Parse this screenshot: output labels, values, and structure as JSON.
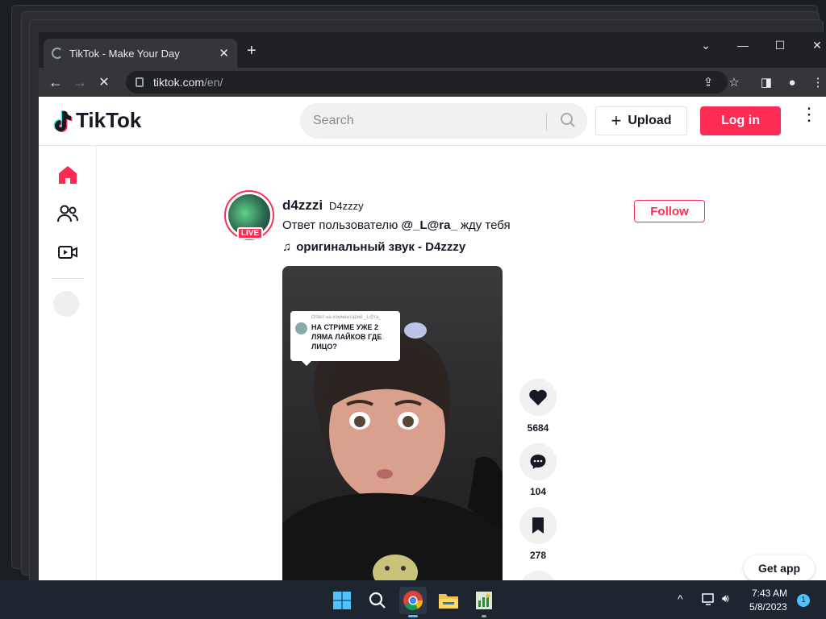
{
  "browser": {
    "tab_title": "TikTok - Make Your Day",
    "url_host": "tiktok.com",
    "url_path": "/en/"
  },
  "header": {
    "logo_text": "TikTok",
    "search_placeholder": "Search",
    "upload_label": "Upload",
    "login_label": "Log in"
  },
  "post": {
    "username": "d4zzzi",
    "nickname": "D4zzzy",
    "live_badge": "LIVE",
    "desc_prefix": "Ответ пользователю ",
    "desc_mention": "@_L@ra_",
    "desc_suffix": " жду тебя",
    "music": "оригинальный звук - D4zzzy",
    "follow_label": "Follow",
    "reply_header": "Ответ на комментарий _L@ra_",
    "reply_text": "НА СТРИМЕ УЖЕ 2 ЛЯМА ЛАЙКОВ ГДЕ ЛИЦО?",
    "likes": "5684",
    "comments": "104",
    "saves": "278"
  },
  "get_app_label": "Get app",
  "taskbar": {
    "time": "7:43 AM",
    "date": "5/8/2023",
    "notification_count": "1"
  },
  "colors": {
    "brand": "#fe2c55",
    "chrome_dark": "#202124",
    "taskbar": "#1c2530"
  }
}
